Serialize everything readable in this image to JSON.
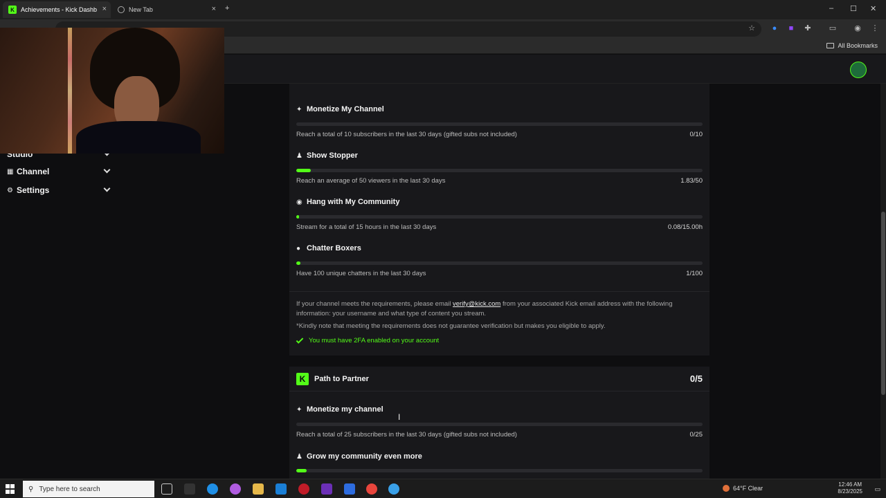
{
  "browser": {
    "tabs": [
      {
        "label": "Achievements - Kick Dashb",
        "active": true
      },
      {
        "label": "New Tab",
        "active": false
      }
    ],
    "bookmarks_label": "All Bookmarks"
  },
  "sidebar": {
    "items": [
      {
        "label": "Studio"
      },
      {
        "label": "Channel"
      },
      {
        "label": "Settings"
      }
    ]
  },
  "verified_section": {
    "achievements": [
      {
        "title": "Monetize My Channel",
        "icon": "sparkle-icon",
        "description": "Reach a total of 10 subscribers in the last 30 days (gifted subs not included)",
        "count": "0/10",
        "progress": 0
      },
      {
        "title": "Show Stopper",
        "icon": "users-icon",
        "description": "Reach an average of 50 viewers in the last 30 days",
        "count": "1.83/50",
        "progress": 0.0366
      },
      {
        "title": "Hang with My Community",
        "icon": "broadcast-icon",
        "description": "Stream for a total of 15 hours in the last 30 days",
        "count": "0.08/15.00h",
        "progress": 0.0053
      },
      {
        "title": "Chatter Boxers",
        "icon": "chat-bubble-icon",
        "description": "Have 100 unique chatters in the last 30 days",
        "count": "1/100",
        "progress": 0.01
      }
    ],
    "info_prefix": "If your channel meets the requirements, please email ",
    "info_email": "verify@kick.com",
    "info_suffix": " from your associated Kick email address with the following information: your username and what type of content you stream.",
    "note": "*Kindly note that meeting the requirements does not guarantee verification but makes you eligible to apply.",
    "requirement": "You must have 2FA enabled on your account"
  },
  "partner_section": {
    "title": "Path to Partner",
    "badge": "K",
    "count": "0/5",
    "achievements": [
      {
        "title": "Monetize my channel",
        "icon": "sparkle-icon",
        "description": "Reach a total of 25 subscribers in the last 30 days (gifted subs not included)",
        "count": "0/25",
        "progress": 0
      },
      {
        "title": "Grow my community even more",
        "icon": "users-icon",
        "progress": 0.025
      }
    ]
  },
  "taskbar": {
    "search_placeholder": "Type here to search",
    "weather": "64°F  Clear",
    "time": "12:46 AM",
    "date": "8/23/2025"
  },
  "colors": {
    "accent": "#53fc18",
    "background": "#0e0e10",
    "card": "#18181b"
  }
}
